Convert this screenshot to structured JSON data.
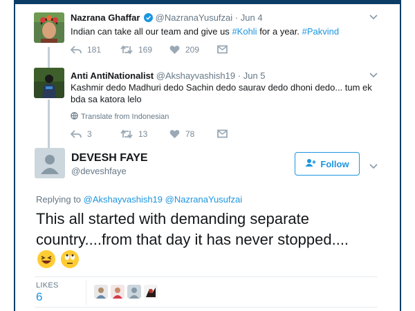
{
  "tweet1": {
    "name": "Nazrana Ghaffar",
    "handle": "@NazranaYusufzai",
    "date": "Jun 4",
    "text_plain": "Indian can take all our team and give us ",
    "hashtag1": "#Kohli",
    "text_mid": " for a year. ",
    "hashtag2": "#Pakvind",
    "replies": "181",
    "retweets": "169",
    "likes": "209",
    "verified": true
  },
  "tweet2": {
    "name": "Anti AntiNationalist",
    "handle": "@Akshayvashish19",
    "date": "Jun 5",
    "text": "Kashmir dedo Madhuri dedo Sachin dedo saurav dedo dhoni dedo... tum ek bda sa katora lelo",
    "translate": "Translate from Indonesian",
    "replies": "3",
    "retweets": "13",
    "likes": "78"
  },
  "main_tweet": {
    "name": "DEVESH FAYE",
    "handle": "@deveshfaye",
    "follow_label": "Follow",
    "replying_prefix": "Replying to ",
    "reply_handle1": "@Akshayvashish19",
    "reply_handle2": "@NazranaYusufzai",
    "text": "This all started with demanding separate country....from that day it has never stopped....",
    "emojis": [
      "laughing-face",
      "rolling-eyes-face"
    ],
    "likes_label": "LIKES",
    "likes_count": "6"
  },
  "colors": {
    "accent": "#1b95e0",
    "frame": "#0b3d66",
    "thread": "#c4cfd6",
    "muted": "#657786"
  }
}
